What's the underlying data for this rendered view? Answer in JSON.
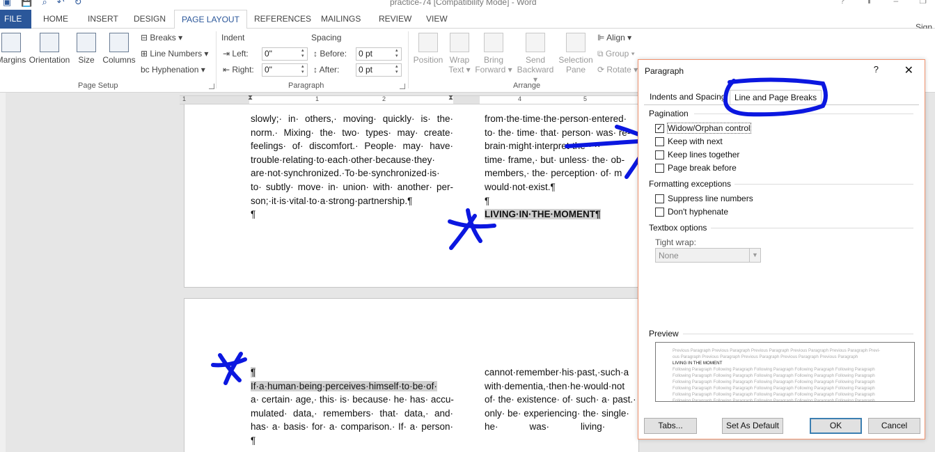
{
  "window": {
    "title": "practice-74 [Compatibility Mode] - Word",
    "sign_in": "Sign"
  },
  "ribbon_tabs": [
    "FILE",
    "HOME",
    "INSERT",
    "DESIGN",
    "PAGE LAYOUT",
    "REFERENCES",
    "MAILINGS",
    "REVIEW",
    "VIEW"
  ],
  "active_tab": "PAGE LAYOUT",
  "page_setup": {
    "margins": "Margins",
    "orientation": "Orientation",
    "size": "Size",
    "columns": "Columns",
    "breaks": "Breaks",
    "line_numbers": "Line Numbers",
    "hyphenation": "Hyphenation",
    "group_label": "Page Setup"
  },
  "paragraph_group": {
    "indent_label": "Indent",
    "spacing_label": "Spacing",
    "left_label": "Left:",
    "left_value": "0\"",
    "right_label": "Right:",
    "right_value": "0\"",
    "before_label": "Before:",
    "before_value": "0 pt",
    "after_label": "After:",
    "after_value": "0 pt",
    "group_label": "Paragraph"
  },
  "arrange_group": {
    "position": "Position",
    "wrap_text_1": "Wrap",
    "wrap_text_2": "Text",
    "bring_forward_1": "Bring",
    "bring_forward_2": "Forward",
    "send_backward_1": "Send",
    "send_backward_2": "Backward",
    "selection_pane_1": "Selection",
    "selection_pane_2": "Pane",
    "align": "Align",
    "group": "Group",
    "rotate": "Rotate",
    "group_label": "Arrange"
  },
  "ruler": {
    "numbers": [
      "1",
      "1",
      "2",
      "3",
      "4",
      "5"
    ]
  },
  "page1": {
    "col1": [
      "slowly;· in· others,· moving· quickly· is· the·",
      "norm.· Mixing· the· two· types· may· create·",
      "feelings· of· discomfort.· People· may· have·",
      "trouble·relating·to·each·other·because·they·",
      "are·not·synchronized.·To·be·synchronized·is·",
      "to· subtly· move· in· union· with· another· per-",
      "son;·it·is·vital·to·a·strong·partnership.¶",
      "¶"
    ],
    "col2": [
      "from·the·time·the·person·entered·",
      "to· the· time· that· person· was· re-",
      "brain·might·interpret·the·· ··",
      "time· frame,· but· unless· the· ob-",
      "members,· the· perception· of· m",
      "would·not·exist.¶",
      "¶"
    ],
    "heading": "LIVING·IN·THE·MOMENT¶"
  },
  "page2": {
    "pilcrow": "¶",
    "col1_first": "If·a·human·being·perceives·himself·to·be·of·",
    "col1": [
      "a· certain· age,· this· is· because· he· has· accu-",
      "mulated· data,· remembers· that· data,· and·",
      "has· a· basis· for· a· comparison.· If· a· person·",
      "¶"
    ],
    "col2": [
      "cannot·remember·his·past,·such·a",
      "with·dementia,·then·he·would·not",
      "of· the· existence· of· such· a· past.·",
      "only· be· experiencing· the· single·",
      "he·            was·            living·"
    ]
  },
  "dialog": {
    "title": "Paragraph",
    "help": "?",
    "close": "✕",
    "tab_indents": "Indents and Spacing",
    "tab_breaks": "Line and Page Breaks",
    "pagination_label": "Pagination",
    "widow_orphan": "Widow/Orphan control",
    "widow_orphan_checked": true,
    "keep_with_next": "Keep with next",
    "keep_lines_together": "Keep lines together",
    "page_break_before": "Page break before",
    "formatting_exceptions_label": "Formatting exceptions",
    "suppress_line_numbers": "Suppress line numbers",
    "dont_hyphenate": "Don't hyphenate",
    "textbox_options_label": "Textbox options",
    "tight_wrap_label": "Tight wrap:",
    "tight_wrap_value": "None",
    "preview_label": "Preview",
    "preview_prev_1": "Previous Paragraph Previous Paragraph Previous Paragraph Previous Paragraph Previous Paragraph Previ-",
    "preview_prev_2": "ous Paragraph Previous Paragraph Previous Paragraph Previous Paragraph Previous Paragraph",
    "preview_current": "LIVING IN THE MOMENT",
    "preview_follow": "Following Paragraph Following Paragraph Following Paragraph Following Paragraph Following Paragraph",
    "tabs_button": "Tabs...",
    "set_default_button": "Set As Default",
    "ok_button": "OK",
    "cancel_button": "Cancel"
  },
  "colors": {
    "accent": "#2b579a",
    "annotation": "#0b17e0",
    "dialog_border": "#f1916c"
  }
}
